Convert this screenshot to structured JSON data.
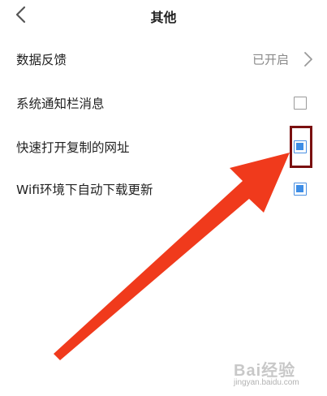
{
  "header": {
    "title": "其他",
    "back_icon": "chevron-left-icon"
  },
  "settings": [
    {
      "label": "数据反馈",
      "value": "已开启",
      "control": "chevron-right-icon"
    },
    {
      "label": "系统通知栏消息",
      "checked": false
    },
    {
      "label": "快速打开复制的网址",
      "checked": true
    },
    {
      "label": "Wifi环境下自动下载更新",
      "checked": true
    }
  ],
  "annotation": {
    "arrow_color": "#f03a1c",
    "box_color": "#7a1010"
  },
  "watermark": {
    "text": "Bai经验",
    "subtext": "jingyan.baidu.com"
  },
  "colors": {
    "accent": "#3d8de6",
    "text": "#222222",
    "muted": "#8a8a8a"
  }
}
